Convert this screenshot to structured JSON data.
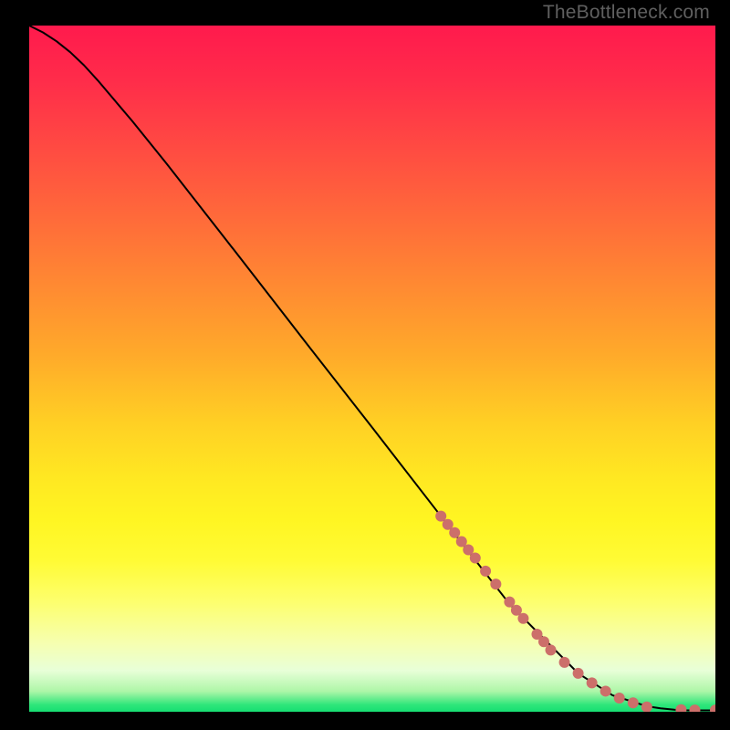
{
  "watermark": "TheBottleneck.com",
  "chart_data": {
    "type": "line",
    "title": "",
    "xlabel": "",
    "ylabel": "",
    "xlim": [
      0,
      100
    ],
    "ylim": [
      0,
      100
    ],
    "background_gradient": {
      "direction": "vertical",
      "stops": [
        {
          "pos": 0,
          "color": "#ff1a4d"
        },
        {
          "pos": 18,
          "color": "#ff4b42"
        },
        {
          "pos": 38,
          "color": "#ff8a32"
        },
        {
          "pos": 58,
          "color": "#ffd024"
        },
        {
          "pos": 78,
          "color": "#fffb35"
        },
        {
          "pos": 94,
          "color": "#e8ffd8"
        },
        {
          "pos": 100,
          "color": "#16de72"
        }
      ]
    },
    "series": [
      {
        "name": "curve",
        "color": "#000000",
        "stroke_width": 2,
        "x": [
          0.0,
          2.0,
          4.0,
          6.0,
          8.0,
          10.0,
          15.0,
          20.0,
          30.0,
          40.0,
          50.0,
          60.0,
          70.0,
          80.0,
          85.0,
          90.0,
          92.0,
          94.0,
          96.0,
          97.0,
          98.0,
          100.0
        ],
        "y": [
          100.0,
          99.0,
          97.7,
          96.1,
          94.2,
          92.0,
          86.1,
          79.9,
          67.1,
          54.2,
          41.4,
          28.5,
          15.7,
          5.6,
          2.4,
          0.8,
          0.5,
          0.3,
          0.2,
          0.2,
          0.2,
          0.2
        ]
      }
    ],
    "scatter": [
      {
        "name": "dots",
        "color": "#cc6f6a",
        "radius": 6,
        "points": [
          {
            "x": 60.0,
            "y": 28.5
          },
          {
            "x": 61.0,
            "y": 27.3
          },
          {
            "x": 62.0,
            "y": 26.1
          },
          {
            "x": 63.0,
            "y": 24.8
          },
          {
            "x": 64.0,
            "y": 23.6
          },
          {
            "x": 65.0,
            "y": 22.4
          },
          {
            "x": 66.5,
            "y": 20.5
          },
          {
            "x": 68.0,
            "y": 18.6
          },
          {
            "x": 70.0,
            "y": 16.0
          },
          {
            "x": 71.0,
            "y": 14.8
          },
          {
            "x": 72.0,
            "y": 13.6
          },
          {
            "x": 74.0,
            "y": 11.3
          },
          {
            "x": 75.0,
            "y": 10.2
          },
          {
            "x": 76.0,
            "y": 9.0
          },
          {
            "x": 78.0,
            "y": 7.2
          },
          {
            "x": 80.0,
            "y": 5.6
          },
          {
            "x": 82.0,
            "y": 4.2
          },
          {
            "x": 84.0,
            "y": 3.0
          },
          {
            "x": 86.0,
            "y": 2.0
          },
          {
            "x": 88.0,
            "y": 1.3
          },
          {
            "x": 90.0,
            "y": 0.7
          },
          {
            "x": 95.0,
            "y": 0.3
          },
          {
            "x": 97.0,
            "y": 0.25
          },
          {
            "x": 100.0,
            "y": 0.25
          }
        ]
      }
    ]
  }
}
